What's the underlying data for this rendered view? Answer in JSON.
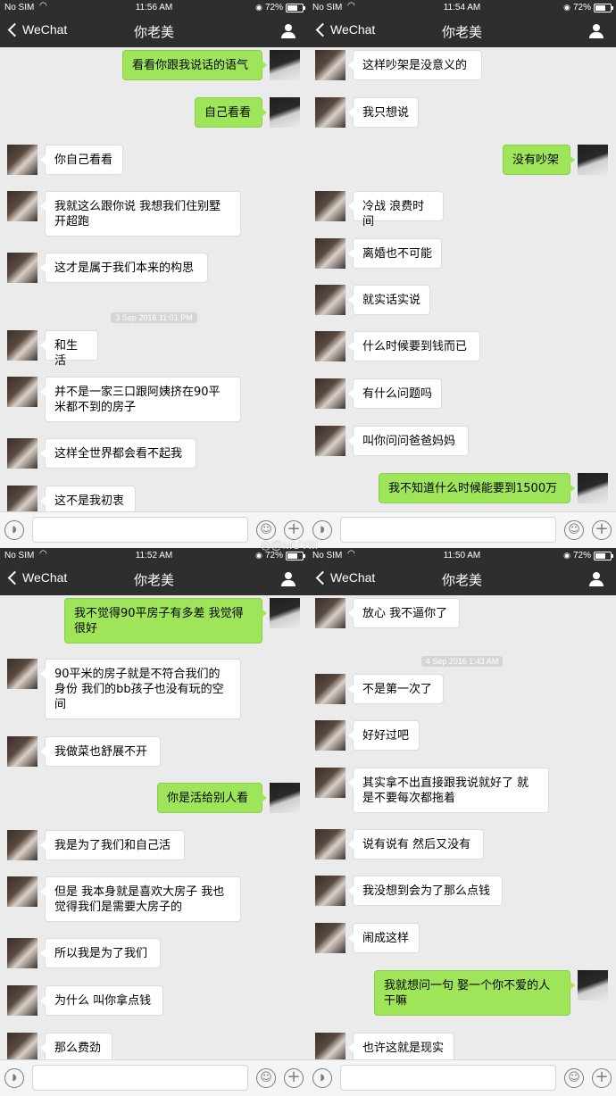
{
  "watermark": "@MUYIII",
  "app_back_label": "WeChat",
  "panels": [
    {
      "status": {
        "carrier": "No SIM",
        "time": "11:56 AM",
        "battery": "72%"
      },
      "title": "你老美",
      "messages": [
        {
          "side": "r",
          "text": "看看你跟我说话的语气"
        },
        {
          "side": "r",
          "text": "自己看看"
        },
        {
          "side": "l",
          "text": "你自己看看"
        },
        {
          "side": "l",
          "text": "我就这么跟你说 我想我们住别墅 开超跑"
        },
        {
          "side": "l",
          "text": "这才是属于我们本来的构思"
        },
        {
          "side": "ts",
          "text": "3 Sep 2016 11:01 PM"
        },
        {
          "side": "l",
          "text": "和生活"
        },
        {
          "side": "l",
          "text": "并不是一家三口跟阿姨挤在90平米都不到的房子"
        },
        {
          "side": "l",
          "text": "这样全世界都会看不起我"
        },
        {
          "side": "l",
          "text": "这不是我初衷"
        }
      ]
    },
    {
      "status": {
        "carrier": "No SIM",
        "time": "11:54 AM",
        "battery": "72%"
      },
      "title": "你老美",
      "messages": [
        {
          "side": "l",
          "text": "这样吵架是没意义的"
        },
        {
          "side": "l",
          "text": "我只想说"
        },
        {
          "side": "r",
          "text": "没有吵架"
        },
        {
          "side": "l",
          "text": "冷战 浪费时间"
        },
        {
          "side": "l",
          "text": "离婚也不可能"
        },
        {
          "side": "l",
          "text": "就实话实说"
        },
        {
          "side": "l",
          "text": "什么时候要到钱而已"
        },
        {
          "side": "l",
          "text": "有什么问题吗"
        },
        {
          "side": "l",
          "text": "叫你问问爸爸妈妈"
        },
        {
          "side": "r",
          "text": "我不知道什么时候能要到1500万"
        }
      ]
    },
    {
      "status": {
        "carrier": "No SIM",
        "time": "11:52 AM",
        "battery": "72%"
      },
      "title": "你老美",
      "messages": [
        {
          "side": "r",
          "text": "我不觉得90平房子有多差 我觉得很好"
        },
        {
          "side": "l",
          "text": "90平米的房子就是不符合我们的身份 我们的bb孩子也没有玩的空间"
        },
        {
          "side": "l",
          "text": "我做菜也舒展不开"
        },
        {
          "side": "r",
          "text": "你是活给别人看"
        },
        {
          "side": "l",
          "text": "我是为了我们和自己活"
        },
        {
          "side": "l",
          "text": "但是 我本身就是喜欢大房子 我也觉得我们是需要大房子的"
        },
        {
          "side": "l",
          "text": "所以我是为了我们"
        },
        {
          "side": "l",
          "text": "为什么 叫你拿点钱"
        },
        {
          "side": "l",
          "text": "那么费劲"
        }
      ]
    },
    {
      "status": {
        "carrier": "No SIM",
        "time": "11:50 AM",
        "battery": "72%"
      },
      "title": "你老美",
      "messages": [
        {
          "side": "l",
          "text": "放心 我不逼你了"
        },
        {
          "side": "ts",
          "text": "4 Sep 2016 1:43 AM"
        },
        {
          "side": "l",
          "text": "不是第一次了"
        },
        {
          "side": "l",
          "text": "好好过吧"
        },
        {
          "side": "l",
          "text": "其实拿不出直接跟我说就好了 就是不要每次都拖着"
        },
        {
          "side": "l",
          "text": "说有说有 然后又没有"
        },
        {
          "side": "l",
          "text": "我没想到会为了那么点钱"
        },
        {
          "side": "l",
          "text": "闹成这样"
        },
        {
          "side": "r",
          "text": "我就想问一句 娶一个你不爱的人干嘛"
        },
        {
          "side": "l",
          "text": "也许这就是现实"
        }
      ]
    }
  ]
}
